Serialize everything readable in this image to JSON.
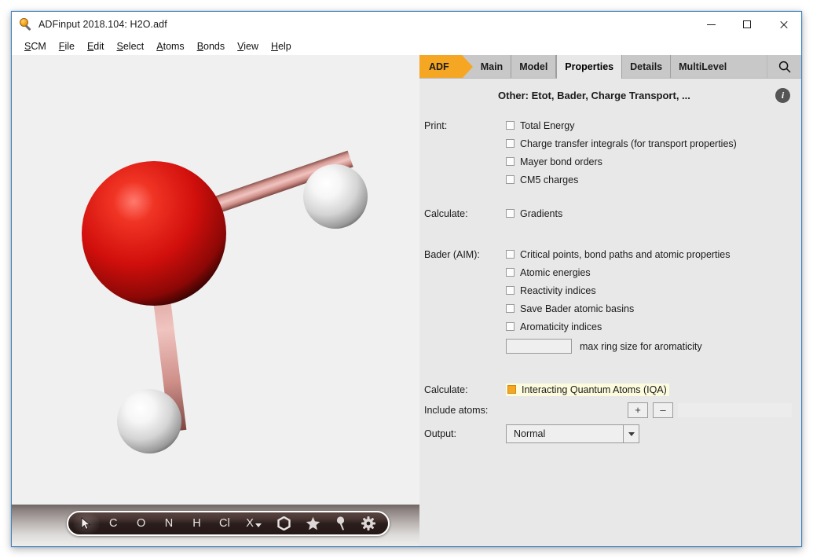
{
  "window": {
    "title": "ADFinput 2018.104: H2O.adf",
    "icon": "magnifier-orange-icon",
    "controls": {
      "minimize": "minimize-icon",
      "maximize": "maximize-icon",
      "close": "close-icon"
    }
  },
  "menubar": {
    "items": [
      {
        "label": "SCM",
        "mnemonic": "S"
      },
      {
        "label": "File",
        "mnemonic": "F"
      },
      {
        "label": "Edit",
        "mnemonic": "E"
      },
      {
        "label": "Select",
        "mnemonic": "S"
      },
      {
        "label": "Atoms",
        "mnemonic": "A"
      },
      {
        "label": "Bonds",
        "mnemonic": "B"
      },
      {
        "label": "View",
        "mnemonic": "V"
      },
      {
        "label": "Help",
        "mnemonic": "H"
      }
    ]
  },
  "viewport": {
    "molecule": "H2O",
    "atoms": [
      {
        "element": "O",
        "color": "#d81818"
      },
      {
        "element": "H",
        "color": "#f2f2f2"
      },
      {
        "element": "H",
        "color": "#f2f2f2"
      }
    ],
    "bond_color": "#e0a0a0",
    "background": "#f0f0f0"
  },
  "atom_toolbar": {
    "items": [
      {
        "label": "",
        "icon": "cursor-arrow-icon",
        "selected": true
      },
      {
        "label": "C",
        "icon": "carbon-atom-label"
      },
      {
        "label": "O",
        "icon": "oxygen-atom-label"
      },
      {
        "label": "N",
        "icon": "nitrogen-atom-label"
      },
      {
        "label": "H",
        "icon": "hydrogen-atom-label"
      },
      {
        "label": "Cl",
        "icon": "chlorine-atom-label"
      },
      {
        "label": "X",
        "icon": "other-element-dropdown"
      },
      {
        "label": "",
        "icon": "benzene-ring-icon"
      },
      {
        "label": "",
        "icon": "star-icon"
      },
      {
        "label": "",
        "icon": "pin-icon"
      },
      {
        "label": "",
        "icon": "gear-icon"
      }
    ]
  },
  "tabs": {
    "items": [
      {
        "label": "ADF",
        "style": "brand",
        "active": false
      },
      {
        "label": "Main",
        "style": "plain",
        "active": false
      },
      {
        "label": "Model",
        "style": "plain",
        "active": false
      },
      {
        "label": "Properties",
        "style": "plain",
        "active": true
      },
      {
        "label": "Details",
        "style": "plain",
        "active": false
      },
      {
        "label": "MultiLevel",
        "style": "plain",
        "active": false
      }
    ],
    "search_icon": "search-icon"
  },
  "panel": {
    "section_title": "Other: Etot, Bader, Charge Transport, ...",
    "info_icon": "info-icon",
    "groups": [
      {
        "label": "Print:",
        "checkboxes": [
          {
            "label": "Total Energy",
            "checked": false
          },
          {
            "label": "Charge transfer integrals (for transport properties)",
            "checked": false
          },
          {
            "label": "Mayer bond orders",
            "checked": false
          },
          {
            "label": "CM5 charges",
            "checked": false
          }
        ]
      },
      {
        "label": "Calculate:",
        "checkboxes": [
          {
            "label": "Gradients",
            "checked": false
          }
        ]
      },
      {
        "label": "Bader (AIM):",
        "checkboxes": [
          {
            "label": "Critical points, bond paths and atomic properties",
            "checked": false
          },
          {
            "label": "Atomic energies",
            "checked": false
          },
          {
            "label": "Reactivity indices",
            "checked": false
          },
          {
            "label": "Save Bader atomic basins",
            "checked": false
          },
          {
            "label": "Aromaticity indices",
            "checked": false
          }
        ],
        "field": {
          "value": "",
          "placeholder": "",
          "side_label": "max ring size for aromaticity"
        }
      }
    ],
    "iqa": {
      "label": "Calculate:",
      "checkbox": {
        "label": "Interacting Quantum Atoms (IQA)",
        "checked": true,
        "highlighted": true
      }
    },
    "include_atoms": {
      "label": "Include atoms:",
      "add_button": "+",
      "remove_button": "–",
      "value": "",
      "placeholder": ""
    },
    "output": {
      "label": "Output:",
      "value": "Normal",
      "options": [
        "Normal"
      ]
    }
  },
  "colors": {
    "brand_orange": "#f5a623",
    "tabbar_gray": "#c8c8c8",
    "panel_gray": "#e8e8e8",
    "highlight_yellow": "#fdfbdd",
    "window_border_blue": "#3b85c9"
  }
}
